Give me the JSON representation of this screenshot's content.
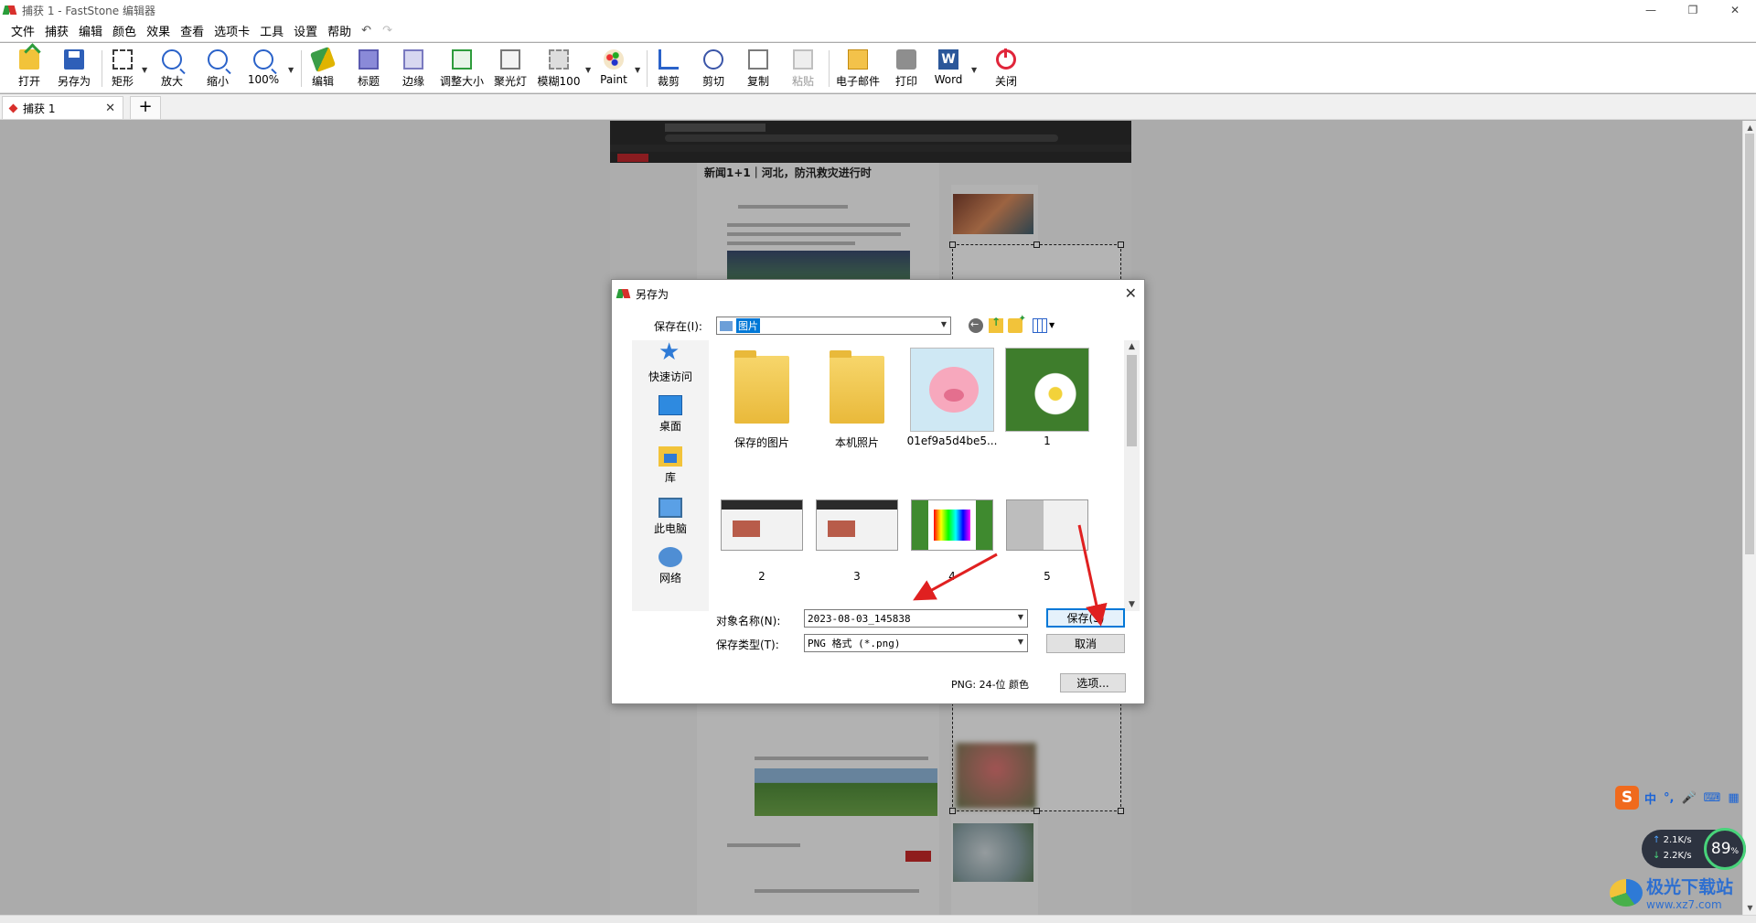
{
  "window": {
    "title": "捕获 1 - FastStone 编辑器",
    "controls": [
      "—",
      "❐",
      "✕"
    ]
  },
  "menu": {
    "items": [
      "文件",
      "捕获",
      "编辑",
      "颜色",
      "效果",
      "查看",
      "选项卡",
      "工具",
      "设置",
      "帮助"
    ],
    "undo": "↶",
    "redo": "↷"
  },
  "toolbar": {
    "buttons": [
      {
        "label": "打开",
        "icon": "open-folder-icon"
      },
      {
        "label": "另存为",
        "icon": "save-as-floppy-icon"
      },
      {
        "label": "矩形",
        "icon": "rectangle-select-icon"
      },
      {
        "label": "放大",
        "icon": "zoom-in-icon"
      },
      {
        "label": "缩小",
        "icon": "zoom-out-icon"
      },
      {
        "label": "100%",
        "icon": "zoom-100-icon"
      },
      {
        "label": "编辑",
        "icon": "edit-pen-icon"
      },
      {
        "label": "标题",
        "icon": "caption-icon"
      },
      {
        "label": "边缘",
        "icon": "edge-icon"
      },
      {
        "label": "调整大小",
        "icon": "resize-icon"
      },
      {
        "label": "聚光灯",
        "icon": "spotlight-icon"
      },
      {
        "label": "模糊100",
        "icon": "blur-icon"
      },
      {
        "label": "Paint",
        "icon": "paint-palette-icon"
      },
      {
        "label": "裁剪",
        "icon": "crop-icon"
      },
      {
        "label": "剪切",
        "icon": "scissors-icon"
      },
      {
        "label": "复制",
        "icon": "copy-icon"
      },
      {
        "label": "粘贴",
        "icon": "paste-icon"
      },
      {
        "label": "电子邮件",
        "icon": "email-icon"
      },
      {
        "label": "打印",
        "icon": "printer-icon"
      },
      {
        "label": "Word",
        "icon": "word-icon"
      },
      {
        "label": "关闭",
        "icon": "power-icon"
      }
    ],
    "word_letter": "W"
  },
  "tabs": {
    "active": "捕获 1",
    "close": "✕",
    "add": "+"
  },
  "screenshot": {
    "headline": "新闻1+1｜河北，防汛救灾进行时"
  },
  "dialog": {
    "title": "另存为",
    "close": "✕",
    "save_in_label": "保存在(I):",
    "save_in_value": "图片",
    "places": [
      "快速访问",
      "桌面",
      "库",
      "此电脑",
      "网络"
    ],
    "files": [
      {
        "name": "保存的图片",
        "kind": "folder"
      },
      {
        "name": "本机照片",
        "kind": "folder"
      },
      {
        "name": "01ef9a5d4be5...",
        "kind": "pig-image"
      },
      {
        "name": "1",
        "kind": "daisy-image"
      },
      {
        "name": "2",
        "kind": "screenshot"
      },
      {
        "name": "3",
        "kind": "screenshot"
      },
      {
        "name": "4",
        "kind": "paint-screenshot"
      },
      {
        "name": "5",
        "kind": "gray-screenshot"
      }
    ],
    "filename_label": "对象名称(N):",
    "filename_value": "2023-08-03_145838",
    "filetype_label": "保存类型(T):",
    "filetype_value": "PNG 格式 (*.png)",
    "save_button": "保存(S)",
    "cancel_button": "取消",
    "format_info": "PNG: 24-位 颜色",
    "options_button": "选项..."
  },
  "ime": {
    "logo": "S",
    "items": [
      "中",
      "°,",
      "🎤",
      "⌨",
      "▦"
    ]
  },
  "net_monitor": {
    "up": "2.1",
    "up_unit": "K/s",
    "down": "2.2",
    "down_unit": "K/s",
    "percent": "89",
    "percent_unit": "%"
  },
  "watermark": {
    "name": "极光下载站",
    "url": "www.xz7.com"
  },
  "colors": {
    "accent_blue": "#0078d7",
    "annotation_red": "#e02020"
  }
}
